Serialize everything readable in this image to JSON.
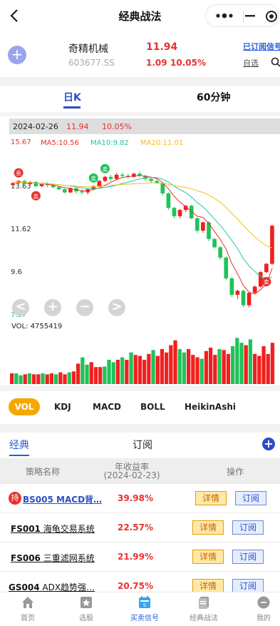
{
  "nav": {
    "title": "经典战法"
  },
  "stock": {
    "name": "奇精机械",
    "code": "603677.SS",
    "price": "11.94",
    "change": "1.09",
    "change_pct": "10.05%",
    "subscribed_label": "已订阅信号",
    "self_select_label": "自选"
  },
  "chart_tabs": [
    "日K",
    "60分钟"
  ],
  "chart_info": {
    "date": "2024-02-26",
    "price": "11.94",
    "pct": "10.05%"
  },
  "ma_legend": {
    "ma5": "MA5:10.56",
    "ma10": "MA10:9.82",
    "ma20": "MA20:11.01"
  },
  "colors": {
    "up": "#f0201f",
    "down": "#1fc25a",
    "ma5": "#e8312f",
    "ma10": "#26c6a0",
    "ma20": "#f2c01a",
    "accent": "#2b4fc7",
    "vol_pill": "#f5a800"
  },
  "chart_data": {
    "type": "candlestick",
    "y_axis_labels": [
      "15.67",
      "13.63",
      "11.62",
      "9.6",
      "7.57"
    ],
    "ylim": [
      7.57,
      15.67
    ],
    "signals": [
      "卖",
      "卖",
      "卖",
      "卖",
      "卖"
    ],
    "volume_label": "VOL: 4755419",
    "candles": [
      [
        13.9,
        14.0,
        13.85,
        14.05
      ],
      [
        14.0,
        14.1,
        13.95,
        14.15
      ],
      [
        14.1,
        13.95,
        13.9,
        14.15
      ],
      [
        13.95,
        14.05,
        13.9,
        14.1
      ],
      [
        14.05,
        13.85,
        13.8,
        14.1
      ],
      [
        13.85,
        13.95,
        13.8,
        14.0
      ],
      [
        13.95,
        13.9,
        13.8,
        14.05
      ],
      [
        13.9,
        13.8,
        13.75,
        13.95
      ],
      [
        13.8,
        13.7,
        13.65,
        13.85
      ],
      [
        13.7,
        13.55,
        13.5,
        13.75
      ],
      [
        13.55,
        13.75,
        13.5,
        13.8
      ],
      [
        13.75,
        13.6,
        13.5,
        13.8
      ],
      [
        13.6,
        13.55,
        13.45,
        13.7
      ],
      [
        13.55,
        13.7,
        13.45,
        13.75
      ],
      [
        13.7,
        13.85,
        13.65,
        13.9
      ],
      [
        13.85,
        14.1,
        13.8,
        14.15
      ],
      [
        14.1,
        14.3,
        14.05,
        14.35
      ],
      [
        14.3,
        14.2,
        14.1,
        14.4
      ],
      [
        14.2,
        14.4,
        14.15,
        14.5
      ],
      [
        14.4,
        14.35,
        14.25,
        14.5
      ],
      [
        14.35,
        14.3,
        14.2,
        14.45
      ],
      [
        14.3,
        14.45,
        14.25,
        14.5
      ],
      [
        14.45,
        14.35,
        14.3,
        14.55
      ],
      [
        14.35,
        14.2,
        14.1,
        14.4
      ],
      [
        14.2,
        14.1,
        14.0,
        14.3
      ],
      [
        14.1,
        14.0,
        13.95,
        14.2
      ],
      [
        14.0,
        13.5,
        13.4,
        14.05
      ],
      [
        13.5,
        12.8,
        12.7,
        13.55
      ],
      [
        12.8,
        12.4,
        12.3,
        12.85
      ],
      [
        12.4,
        12.7,
        12.3,
        12.75
      ],
      [
        12.7,
        12.9,
        12.6,
        12.95
      ],
      [
        12.9,
        12.3,
        12.25,
        12.95
      ],
      [
        12.3,
        11.7,
        11.6,
        12.35
      ],
      [
        11.7,
        12.1,
        11.6,
        12.15
      ],
      [
        12.1,
        11.3,
        11.2,
        12.15
      ],
      [
        11.3,
        10.9,
        10.85,
        11.35
      ],
      [
        10.9,
        10.4,
        10.3,
        10.95
      ],
      [
        10.4,
        9.4,
        9.3,
        10.45
      ],
      [
        9.4,
        8.6,
        8.5,
        9.45
      ],
      [
        8.6,
        8.8,
        8.4,
        8.85
      ],
      [
        8.8,
        8.1,
        8.0,
        8.85
      ],
      [
        8.1,
        8.7,
        8.0,
        8.75
      ],
      [
        8.7,
        9.0,
        8.65,
        9.05
      ],
      [
        9.0,
        9.7,
        8.95,
        9.75
      ],
      [
        9.7,
        10.1,
        9.65,
        10.15
      ],
      [
        10.1,
        11.94,
        10.05,
        11.99
      ]
    ],
    "volumes": [
      0.22,
      0.22,
      0.18,
      0.2,
      0.22,
      0.2,
      0.2,
      0.22,
      0.2,
      0.22,
      0.2,
      0.24,
      0.2,
      0.24,
      0.26,
      0.42,
      0.55,
      0.4,
      0.45,
      0.35,
      0.35,
      0.36,
      0.5,
      0.45,
      0.5,
      0.55,
      0.5,
      0.65,
      0.6,
      0.58,
      0.5,
      0.62,
      0.7,
      0.58,
      0.72,
      0.65,
      0.8,
      0.9,
      0.72,
      0.65,
      0.72,
      0.6,
      0.55,
      0.52,
      0.68,
      0.75,
      0.6,
      0.72,
      0.7,
      0.62,
      0.78,
      0.95,
      0.85,
      0.8,
      0.92,
      0.62,
      0.58,
      0.78,
      0.62,
      0.85
    ]
  },
  "controls": [
    "<",
    "+",
    "−",
    ">"
  ],
  "indicator_tabs": [
    "VOL",
    "KDJ",
    "MACD",
    "BOLL",
    "HeikinAshi"
  ],
  "strategy_tabs": [
    "经典",
    "订阅"
  ],
  "table": {
    "col_name": "策略名称",
    "col_yield": "年收益率",
    "col_yield_date": "(2024-02-23)",
    "col_op": "操作",
    "detail_label": "详情",
    "subscribe_label": "订阅",
    "hold_badge": "持",
    "rows": [
      {
        "code": "BS005",
        "name": "MACD背…",
        "yield": "39.98%"
      },
      {
        "code": "FS001",
        "name": "海龟交易系统",
        "yield": "22.57%"
      },
      {
        "code": "FS006",
        "name": "三重滤网系统",
        "yield": "21.99%"
      },
      {
        "code": "GS004",
        "name": "ADX趋势强…",
        "yield": "20.75%"
      }
    ]
  },
  "tabbar": [
    "首页",
    "选股",
    "买卖信号",
    "经典战法",
    "我的"
  ]
}
